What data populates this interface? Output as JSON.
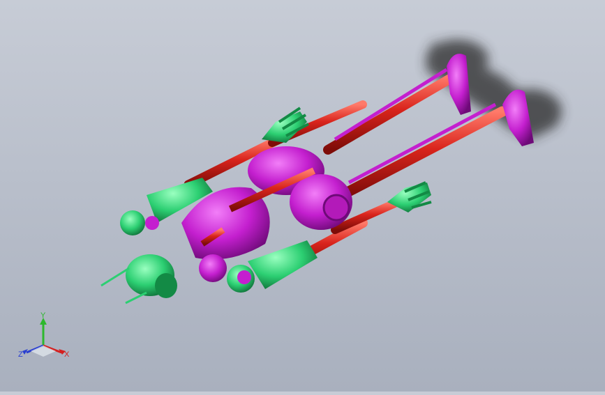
{
  "viewport": {
    "background_top": "#c7ccd6",
    "background_bottom": "#a9b0be",
    "model": {
      "colors": {
        "body_magenta": "#c41fcf",
        "body_magenta_dark": "#7d0d86",
        "rod_red": "#d9241c",
        "rod_red_dark": "#8a0f0b",
        "part_green": "#2ccf72",
        "part_green_dark": "#138a45",
        "shadow": "#2a2a2a"
      }
    }
  },
  "triad": {
    "y_label": "Y",
    "z_label": "Z",
    "x_label": "X",
    "y_color": "#2db82d",
    "z_color": "#2a3fd0",
    "x_color": "#d42020"
  }
}
